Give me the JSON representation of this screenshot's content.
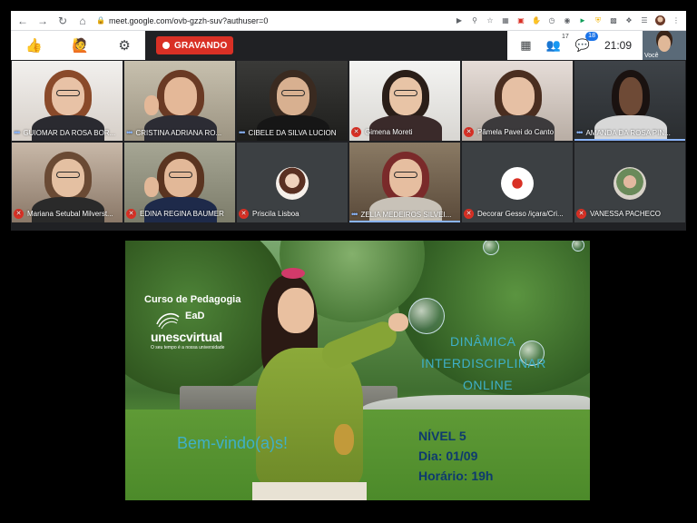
{
  "browser": {
    "url": "meet.google.com/ovb-gzzh-suv?authuser=0"
  },
  "meet_bar": {
    "recording_label": "GRAVANDO",
    "participants_count": "17",
    "chat_count": "18",
    "clock": "21:09",
    "self_label": "Você"
  },
  "participants": [
    {
      "name": "GUIOMAR DA ROSA BOR...",
      "state": "speaking-dots"
    },
    {
      "name": "CRISTINA ADRIANA RO...",
      "state": "speaking-dots"
    },
    {
      "name": "CIBELE DA SILVA LUCION",
      "state": "speaking-dots"
    },
    {
      "name": "Gimena Moreti",
      "state": "muted"
    },
    {
      "name": "Pâmela Pavei do Canto",
      "state": "muted"
    },
    {
      "name": "AMANDA DA ROSA PIN...",
      "state": "speaking"
    },
    {
      "name": "Mariana Setubal Milverst...",
      "state": "muted"
    },
    {
      "name": "EDINA REGINA BAUMER",
      "state": "muted"
    },
    {
      "name": "Priscila Lisboa",
      "state": "muted"
    },
    {
      "name": "ZELIA MEDEIROS SILVEI...",
      "state": "speaking"
    },
    {
      "name": "Decorar Gesso /içara/Cri...",
      "state": "muted"
    },
    {
      "name": "VANESSA PACHECO",
      "state": "muted"
    }
  ],
  "banner": {
    "course_line": "Curso de Pedagogia",
    "ead_line": "EaD",
    "brand": "unescvirtual",
    "tagline": "O seu tempo é a nossa universidade",
    "dynamic_line1": "DINÂMICA",
    "dynamic_line2": "INTERDISCIPLINAR",
    "dynamic_line3": "ONLINE",
    "welcome": "Bem-vindo(a)s!",
    "level": "NÍVEL 5",
    "date": "Dia: 01/09",
    "time": "Horário: 19h"
  },
  "colors": {
    "recording_red": "#d93025",
    "meet_dark": "#202124",
    "speaking_blue": "#8ab4f8",
    "banner_cyan": "#3fb0c8",
    "banner_navy": "#0e3a6e"
  }
}
